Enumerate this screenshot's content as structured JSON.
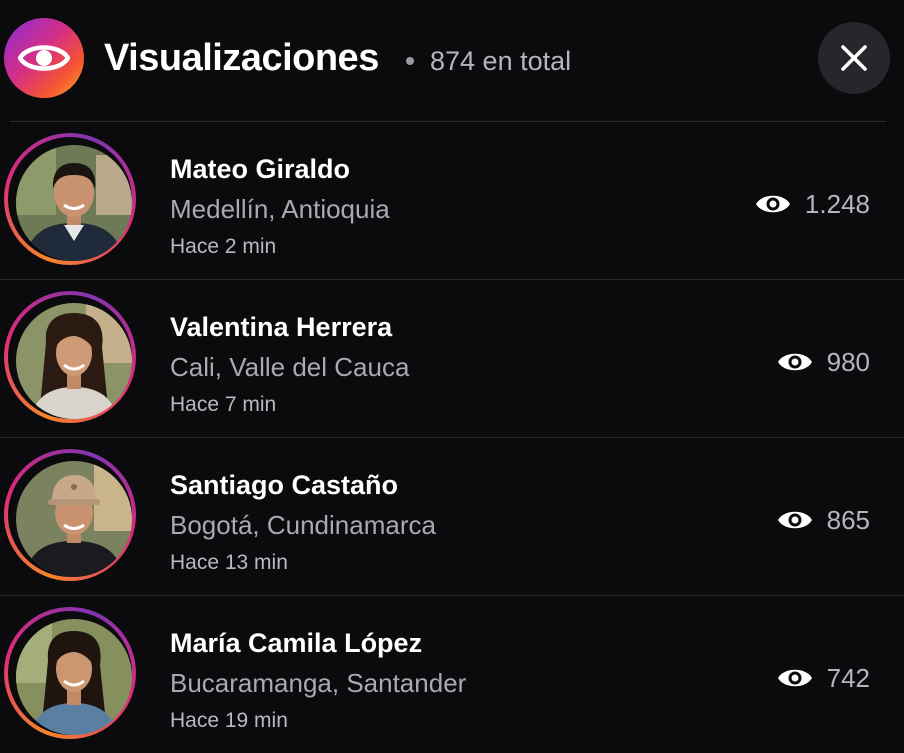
{
  "header": {
    "title": "Visualizaciones",
    "total": "874 en total",
    "logo_icon": "eye-icon",
    "close_icon": "close-icon"
  },
  "colors": {
    "background": "#0b0b0e",
    "accent_gradient": [
      "#f58529",
      "#dd2a7b",
      "#8134af"
    ],
    "secondary_text": "#a9a9b1"
  },
  "viewers": [
    {
      "name": "Mateo Giraldo",
      "location": "Medellín, Antioquia",
      "time": "Hace 2 min",
      "views": "1.248",
      "avatar": "man-short-dark-hair"
    },
    {
      "name": "Valentina Herrera",
      "location": "Cali, Valle del Cauca",
      "time": "Hace 7 min",
      "views": "980",
      "avatar": "woman-long-dark-hair"
    },
    {
      "name": "Santiago Castaño",
      "location": "Bogotá, Cundinamarca",
      "time": "Hace 13 min",
      "views": "865",
      "avatar": "man-with-cap"
    },
    {
      "name": "María Camila López",
      "location": "Bucaramanga, Santander",
      "time": "Hace 19 min",
      "views": "742",
      "avatar": "woman-long-hair"
    }
  ]
}
